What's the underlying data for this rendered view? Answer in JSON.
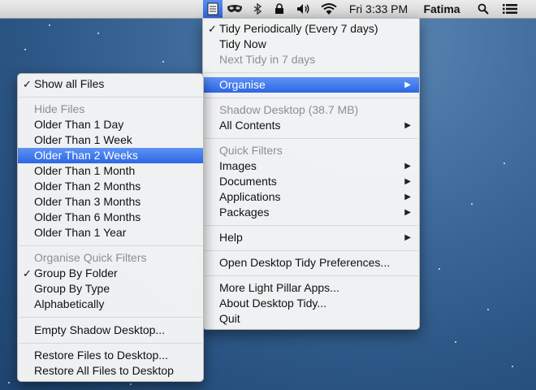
{
  "menubar": {
    "clock": "Fri 3:33 PM",
    "user": "Fatima",
    "icons": [
      "desktop-tidy-icon",
      "mask-icon",
      "bluetooth-icon",
      "lock-icon",
      "volume-icon",
      "wifi-icon",
      "spotlight-icon",
      "notification-center-icon"
    ]
  },
  "main_menu": {
    "tidy_periodically": "Tidy Periodically (Every 7 days)",
    "tidy_now": "Tidy Now",
    "next_tidy": "Next Tidy in 7 days",
    "organise": "Organise",
    "shadow_desktop": "Shadow Desktop (38.7 MB)",
    "all_contents": "All Contents",
    "quick_filters": "Quick Filters",
    "images": "Images",
    "documents": "Documents",
    "applications": "Applications",
    "packages": "Packages",
    "help": "Help",
    "preferences": "Open Desktop Tidy Preferences...",
    "more_apps": "More Light Pillar Apps...",
    "about": "About Desktop Tidy...",
    "quit": "Quit"
  },
  "organise_menu": {
    "show_all_files": "Show all Files",
    "hide_files_header": "Hide Files",
    "hide_options": [
      "Older Than 1 Day",
      "Older Than 1 Week",
      "Older Than 2 Weeks",
      "Older Than 1 Month",
      "Older Than 2 Months",
      "Older Than 3 Months",
      "Older Than 6 Months",
      "Older Than 1 Year"
    ],
    "organise_header": "Organise Quick Filters",
    "group_by_folder": "Group By Folder",
    "group_by_type": "Group By Type",
    "alphabetically": "Alphabetically",
    "empty_shadow": "Empty Shadow Desktop...",
    "restore_files": "Restore Files to Desktop...",
    "restore_all": "Restore All Files to Desktop"
  },
  "glyphs": {
    "check": "✓",
    "submenu_arrow": "▶"
  },
  "colors": {
    "highlight": "#2d66e6",
    "menubar": "#dcdcdc",
    "desktop": "#2c5685"
  }
}
